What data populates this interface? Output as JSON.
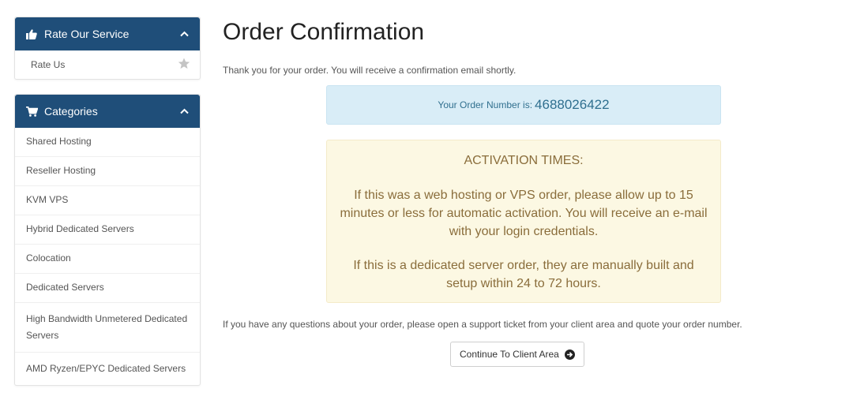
{
  "sidebar": {
    "rate_panel": {
      "title": "Rate Our Service",
      "icon": "thumbs-up-icon",
      "item_label": "Rate Us",
      "item_icon": "star-icon"
    },
    "categories_panel": {
      "title": "Categories",
      "icon": "shopping-cart-icon",
      "items": [
        "Shared Hosting",
        "Reseller Hosting",
        "KVM VPS",
        "Hybrid Dedicated Servers",
        "Colocation",
        "Dedicated Servers",
        "High Bandwidth Unmetered Dedicated Servers",
        "AMD Ryzen/EPYC Dedicated Servers"
      ]
    }
  },
  "main": {
    "title": "Order Confirmation",
    "thanks": "Thank you for your order. You will receive a confirmation email shortly.",
    "order_label": "Your Order Number is:",
    "order_number": "4688026422",
    "activation": {
      "heading": "ACTIVATION TIMES:",
      "para1": "If this was a web hosting or VPS order, please allow up to 15 minutes or less for automatic activation. You will receive an e-mail with your login credentials.",
      "para2": "If this is a dedicated server order, they are manually built and setup within 24 to 72 hours."
    },
    "questions": "If you have any questions about your order, please open a support ticket from your client area and quote your order number.",
    "continue_label": "Continue To Client Area"
  },
  "colors": {
    "panel_header": "#1f4e79",
    "info_bg": "#d9edf7",
    "warning_bg": "#fcf8e3",
    "warning_text": "#8a6d3b"
  }
}
